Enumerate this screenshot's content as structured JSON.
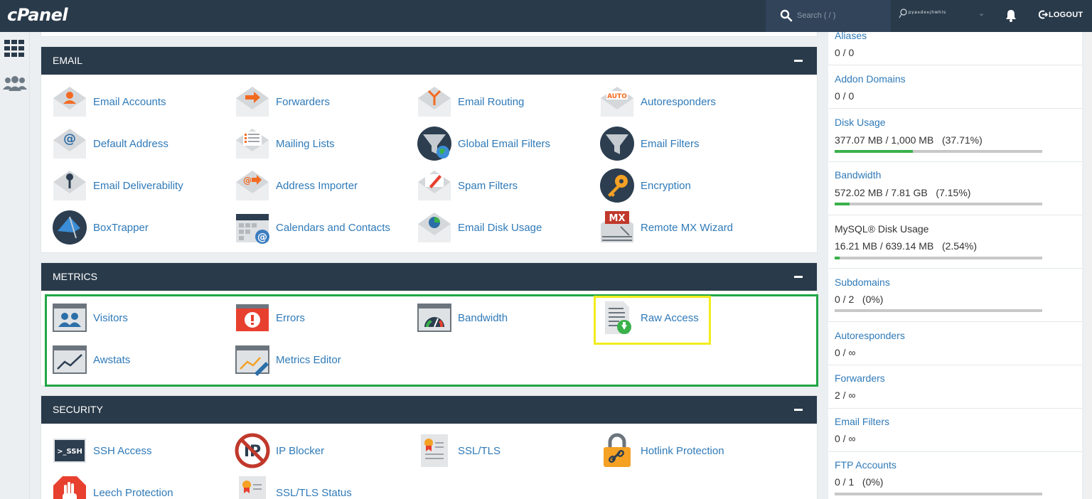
{
  "topbar": {
    "logo": "cPanel",
    "search_placeholder": "Search ( / )",
    "username": "ᵖʸᵃⁿᵈᵉⁿʲʰʷʰˡˢ",
    "logout_label": "LOGOUT"
  },
  "sections": [
    {
      "title": "EMAIL",
      "items": [
        {
          "label": "Email Accounts",
          "icon": "email-accounts-icon"
        },
        {
          "label": "Forwarders",
          "icon": "forwarders-icon"
        },
        {
          "label": "Email Routing",
          "icon": "email-routing-icon"
        },
        {
          "label": "Autoresponders",
          "icon": "autoresponders-icon"
        },
        {
          "label": "Default Address",
          "icon": "default-address-icon"
        },
        {
          "label": "Mailing Lists",
          "icon": "mailing-lists-icon"
        },
        {
          "label": "Global Email Filters",
          "icon": "global-email-filters-icon"
        },
        {
          "label": "Email Filters",
          "icon": "email-filters-icon"
        },
        {
          "label": "Email Deliverability",
          "icon": "email-deliverability-icon"
        },
        {
          "label": "Address Importer",
          "icon": "address-importer-icon"
        },
        {
          "label": "Spam Filters",
          "icon": "spam-filters-icon"
        },
        {
          "label": "Encryption",
          "icon": "encryption-icon"
        },
        {
          "label": "BoxTrapper",
          "icon": "boxtrapper-icon"
        },
        {
          "label": "Calendars and Contacts",
          "icon": "calendars-contacts-icon"
        },
        {
          "label": "Email Disk Usage",
          "icon": "email-disk-usage-icon"
        },
        {
          "label": "Remote MX Wizard",
          "icon": "remote-mx-wizard-icon"
        }
      ]
    },
    {
      "title": "METRICS",
      "items": [
        {
          "label": "Visitors",
          "icon": "visitors-icon"
        },
        {
          "label": "Errors",
          "icon": "errors-icon"
        },
        {
          "label": "Bandwidth",
          "icon": "bandwidth-icon"
        },
        {
          "label": "Raw Access",
          "icon": "raw-access-icon"
        },
        {
          "label": "Awstats",
          "icon": "awstats-icon"
        },
        {
          "label": "Metrics Editor",
          "icon": "metrics-editor-icon"
        }
      ]
    },
    {
      "title": "SECURITY",
      "items": [
        {
          "label": "SSH Access",
          "icon": "ssh-access-icon"
        },
        {
          "label": "IP Blocker",
          "icon": "ip-blocker-icon"
        },
        {
          "label": "SSL/TLS",
          "icon": "ssl-tls-icon"
        },
        {
          "label": "Hotlink Protection",
          "icon": "hotlink-protection-icon"
        },
        {
          "label": "Leech Protection",
          "icon": "leech-protection-icon"
        },
        {
          "label": "SSL/TLS Status",
          "icon": "ssl-tls-status-icon"
        }
      ]
    }
  ],
  "stats": [
    {
      "name": "Aliases",
      "value": "0 / 0"
    },
    {
      "name": "Addon Domains",
      "value": "0 / 0"
    },
    {
      "name": "Disk Usage",
      "value": "377.07 MB / 1,000 MB   (37.71%)",
      "percent": 37.71
    },
    {
      "name": "Bandwidth",
      "value": "572.02 MB / 7.81 GB   (7.15%)",
      "percent": 7.15
    },
    {
      "name": "MySQL® Disk Usage",
      "value": "16.21 MB / 639.14 MB   (2.54%)",
      "percent": 2.54
    },
    {
      "name": "Subdomains",
      "value": "0 / 2   (0%)",
      "percent": 0
    },
    {
      "name": "Autoresponders",
      "value": "0 / ∞"
    },
    {
      "name": "Forwarders",
      "value": "2 / ∞"
    },
    {
      "name": "Email Filters",
      "value": "0 / ∞"
    },
    {
      "name": "FTP Accounts",
      "value": "0 / 1   (0%)",
      "percent": 0
    }
  ],
  "colors": {
    "header": "#293a4a",
    "link": "#2f7ab8",
    "progress": "#3ab14a",
    "highlight_green": "#21a646",
    "highlight_yellow": "#f2ec1d"
  }
}
